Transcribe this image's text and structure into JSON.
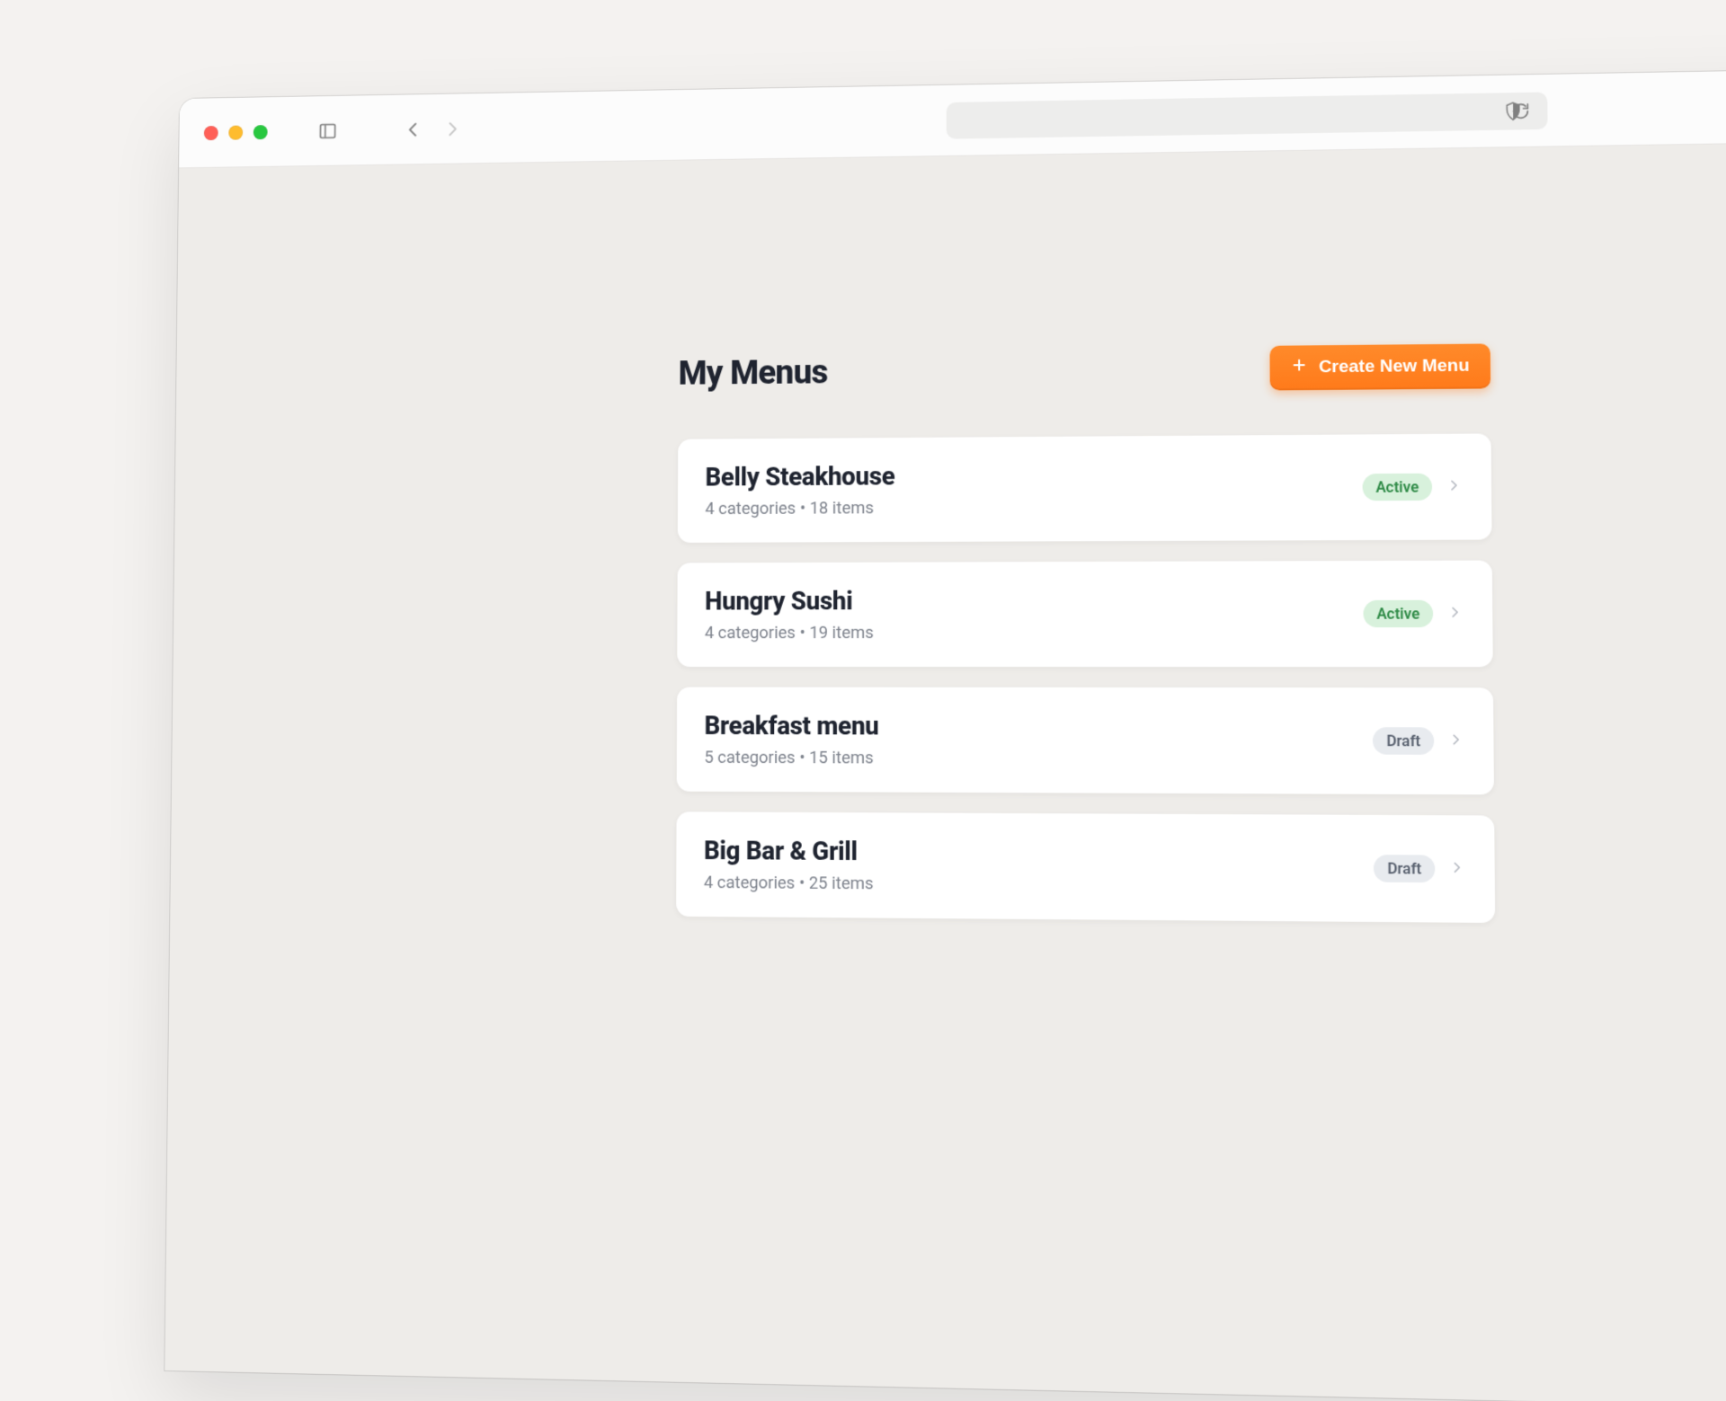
{
  "header": {
    "title": "My Menus",
    "create_label": "Create New Menu"
  },
  "badges": {
    "active": "Active",
    "draft": "Draft"
  },
  "menus": [
    {
      "name": "Belly Steakhouse",
      "subtitle": "4 categories • 18 items",
      "status": "active"
    },
    {
      "name": "Hungry Sushi",
      "subtitle": "4 categories • 19 items",
      "status": "active"
    },
    {
      "name": "Breakfast menu",
      "subtitle": "5 categories • 15 items",
      "status": "draft"
    },
    {
      "name": "Big Bar & Grill",
      "subtitle": "4 categories • 25 items",
      "status": "draft"
    }
  ]
}
